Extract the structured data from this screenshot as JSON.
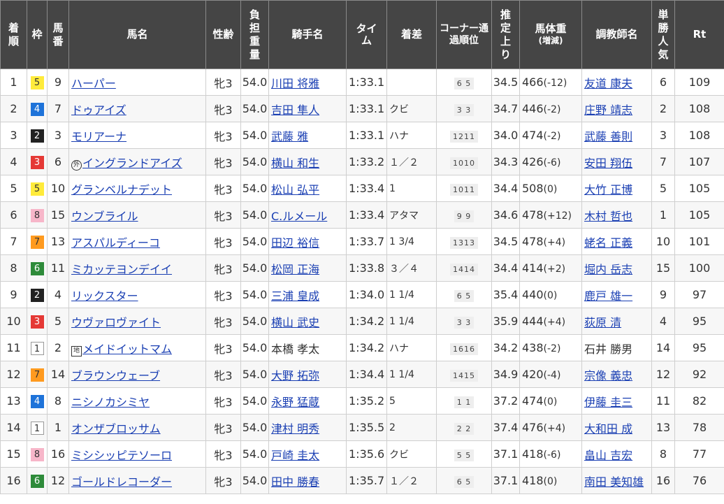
{
  "headers": {
    "rank": "着順",
    "waku": "枠",
    "umaban": "馬番",
    "horse": "馬名",
    "sexage": "性齢",
    "weight": "負担重量",
    "jockey": "騎手名",
    "time": "タイム",
    "margin": "着差",
    "corner": "コーナー通過順位",
    "last3f": "推定上り",
    "bodyweight": "馬体重",
    "bodyweight_sub": "(増減)",
    "trainer": "調教師名",
    "pop": "単勝人気",
    "rt": "Rt"
  },
  "waku_colors": {
    "1": "#ffffff",
    "2": "#222222",
    "3": "#e53935",
    "4": "#1e73d9",
    "5": "#ffeb3b",
    "6": "#2e8b3a",
    "7": "#ff9a1f",
    "8": "#f7b6c9"
  },
  "rows": [
    {
      "rank": "1",
      "waku": "5",
      "umaban": "9",
      "mark": "",
      "horse": "ハーパー",
      "sexage": "牝3",
      "weight": "54.0",
      "jockey": "川田 将雅",
      "jockey_link": true,
      "time": "1:33.1",
      "margin": "",
      "corner": "6 5",
      "last3f": "34.5",
      "bw": "466",
      "bwc": "(-12)",
      "trainer": "友道 康夫",
      "trainer_link": true,
      "pop": "6",
      "rt": "109"
    },
    {
      "rank": "2",
      "waku": "4",
      "umaban": "7",
      "mark": "",
      "horse": "ドゥアイズ",
      "sexage": "牝3",
      "weight": "54.0",
      "jockey": "吉田 隼人",
      "jockey_link": true,
      "time": "1:33.1",
      "margin": "クビ",
      "corner": "3 3",
      "last3f": "34.7",
      "bw": "446",
      "bwc": "(-2)",
      "trainer": "庄野 靖志",
      "trainer_link": true,
      "pop": "2",
      "rt": "108"
    },
    {
      "rank": "3",
      "waku": "2",
      "umaban": "3",
      "mark": "",
      "horse": "モリアーナ",
      "sexage": "牝3",
      "weight": "54.0",
      "jockey": "武藤 雅",
      "jockey_link": true,
      "time": "1:33.1",
      "margin": "ハナ",
      "corner": "1211",
      "last3f": "34.0",
      "bw": "474",
      "bwc": "(-2)",
      "trainer": "武藤 善則",
      "trainer_link": true,
      "pop": "3",
      "rt": "108"
    },
    {
      "rank": "4",
      "waku": "3",
      "umaban": "6",
      "mark": "外",
      "horse": "イングランドアイズ",
      "sexage": "牝3",
      "weight": "54.0",
      "jockey": "横山 和生",
      "jockey_link": true,
      "time": "1:33.2",
      "margin": "１／２",
      "corner": "1010",
      "last3f": "34.3",
      "bw": "426",
      "bwc": "(-6)",
      "trainer": "安田 翔伍",
      "trainer_link": true,
      "pop": "7",
      "rt": "107"
    },
    {
      "rank": "5",
      "waku": "5",
      "umaban": "10",
      "mark": "",
      "horse": "グランベルナデット",
      "sexage": "牝3",
      "weight": "54.0",
      "jockey": "松山 弘平",
      "jockey_link": true,
      "time": "1:33.4",
      "margin": "1",
      "corner": "1011",
      "last3f": "34.4",
      "bw": "508",
      "bwc": "(0)",
      "trainer": "大竹 正博",
      "trainer_link": true,
      "pop": "5",
      "rt": "105"
    },
    {
      "rank": "6",
      "waku": "8",
      "umaban": "15",
      "mark": "",
      "horse": "ウンブライル",
      "sexage": "牝3",
      "weight": "54.0",
      "jockey": "C.ルメール",
      "jockey_link": true,
      "time": "1:33.4",
      "margin": "アタマ",
      "corner": "9 9",
      "last3f": "34.6",
      "bw": "478",
      "bwc": "(+12)",
      "trainer": "木村 哲也",
      "trainer_link": true,
      "pop": "1",
      "rt": "105"
    },
    {
      "rank": "7",
      "waku": "7",
      "umaban": "13",
      "mark": "",
      "horse": "アスパルディーコ",
      "sexage": "牝3",
      "weight": "54.0",
      "jockey": "田辺 裕信",
      "jockey_link": true,
      "time": "1:33.7",
      "margin": "1 3/4",
      "corner": "1313",
      "last3f": "34.5",
      "bw": "478",
      "bwc": "(+4)",
      "trainer": "蛯名 正義",
      "trainer_link": true,
      "pop": "10",
      "rt": "101"
    },
    {
      "rank": "8",
      "waku": "6",
      "umaban": "11",
      "mark": "",
      "horse": "ミカッテヨンデイイ",
      "sexage": "牝3",
      "weight": "54.0",
      "jockey": "松岡 正海",
      "jockey_link": true,
      "time": "1:33.8",
      "margin": "３／４",
      "corner": "1414",
      "last3f": "34.4",
      "bw": "414",
      "bwc": "(+2)",
      "trainer": "堀内 岳志",
      "trainer_link": true,
      "pop": "15",
      "rt": "100"
    },
    {
      "rank": "9",
      "waku": "2",
      "umaban": "4",
      "mark": "",
      "horse": "リックスター",
      "sexage": "牝3",
      "weight": "54.0",
      "jockey": "三浦 皇成",
      "jockey_link": true,
      "time": "1:34.0",
      "margin": "1 1/4",
      "corner": "6 5",
      "last3f": "35.4",
      "bw": "440",
      "bwc": "(0)",
      "trainer": "鹿戸 雄一",
      "trainer_link": true,
      "pop": "9",
      "rt": "97"
    },
    {
      "rank": "10",
      "waku": "3",
      "umaban": "5",
      "mark": "",
      "horse": "ウヴァロヴァイト",
      "sexage": "牝3",
      "weight": "54.0",
      "jockey": "横山 武史",
      "jockey_link": true,
      "time": "1:34.2",
      "margin": "1 1/4",
      "corner": "3 3",
      "last3f": "35.9",
      "bw": "444",
      "bwc": "(+4)",
      "trainer": "荻原 清",
      "trainer_link": true,
      "pop": "4",
      "rt": "95"
    },
    {
      "rank": "11",
      "waku": "1",
      "umaban": "2",
      "mark": "地",
      "horse": "メイドイットマム",
      "sexage": "牝3",
      "weight": "54.0",
      "jockey": "本橋 孝太",
      "jockey_link": false,
      "time": "1:34.2",
      "margin": "ハナ",
      "corner": "1616",
      "last3f": "34.2",
      "bw": "438",
      "bwc": "(-2)",
      "trainer": "石井 勝男",
      "trainer_link": false,
      "pop": "14",
      "rt": "95"
    },
    {
      "rank": "12",
      "waku": "7",
      "umaban": "14",
      "mark": "",
      "horse": "ブラウンウェーブ",
      "sexage": "牝3",
      "weight": "54.0",
      "jockey": "大野 拓弥",
      "jockey_link": true,
      "time": "1:34.4",
      "margin": "1 1/4",
      "corner": "1415",
      "last3f": "34.9",
      "bw": "420",
      "bwc": "(-4)",
      "trainer": "宗像 義忠",
      "trainer_link": true,
      "pop": "12",
      "rt": "92"
    },
    {
      "rank": "13",
      "waku": "4",
      "umaban": "8",
      "mark": "",
      "horse": "ニシノカシミヤ",
      "sexage": "牝3",
      "weight": "54.0",
      "jockey": "永野 猛蔵",
      "jockey_link": true,
      "time": "1:35.2",
      "margin": "5",
      "corner": "1 1",
      "last3f": "37.2",
      "bw": "474",
      "bwc": "(0)",
      "trainer": "伊藤 圭三",
      "trainer_link": true,
      "pop": "11",
      "rt": "82"
    },
    {
      "rank": "14",
      "waku": "1",
      "umaban": "1",
      "mark": "",
      "horse": "オンザブロッサム",
      "sexage": "牝3",
      "weight": "54.0",
      "jockey": "津村 明秀",
      "jockey_link": true,
      "time": "1:35.5",
      "margin": "2",
      "corner": "2 2",
      "last3f": "37.4",
      "bw": "476",
      "bwc": "(+4)",
      "trainer": "大和田 成",
      "trainer_link": true,
      "pop": "13",
      "rt": "78"
    },
    {
      "rank": "15",
      "waku": "8",
      "umaban": "16",
      "mark": "",
      "horse": "ミシシッピテソーロ",
      "sexage": "牝3",
      "weight": "54.0",
      "jockey": "戸崎 圭太",
      "jockey_link": true,
      "time": "1:35.6",
      "margin": "クビ",
      "corner": "5 5",
      "last3f": "37.1",
      "bw": "418",
      "bwc": "(-6)",
      "trainer": "畠山 吉宏",
      "trainer_link": true,
      "pop": "8",
      "rt": "77"
    },
    {
      "rank": "16",
      "waku": "6",
      "umaban": "12",
      "mark": "",
      "horse": "ゴールドレコーダー",
      "sexage": "牝3",
      "weight": "54.0",
      "jockey": "田中 勝春",
      "jockey_link": true,
      "time": "1:35.7",
      "margin": "１／２",
      "corner": "6 5",
      "last3f": "37.1",
      "bw": "418",
      "bwc": "(0)",
      "trainer": "南田 美知雄",
      "trainer_link": true,
      "pop": "16",
      "rt": "76"
    }
  ]
}
